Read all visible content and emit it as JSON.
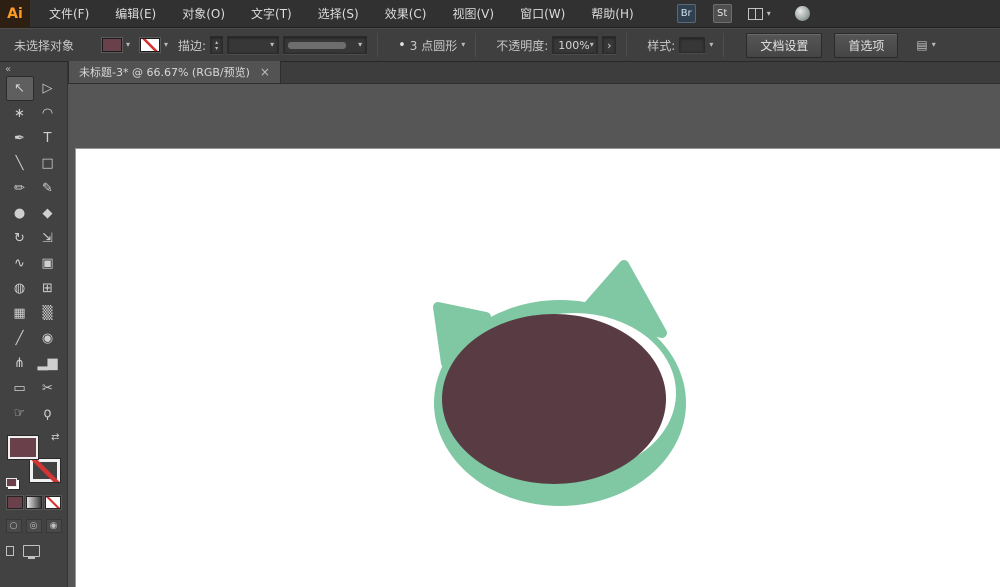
{
  "menubar": {
    "logo": "Ai",
    "items": [
      {
        "name": "file",
        "label": "文件(F)"
      },
      {
        "name": "edit",
        "label": "编辑(E)"
      },
      {
        "name": "object",
        "label": "对象(O)"
      },
      {
        "name": "type",
        "label": "文字(T)"
      },
      {
        "name": "select",
        "label": "选择(S)"
      },
      {
        "name": "effect",
        "label": "效果(C)"
      },
      {
        "name": "view",
        "label": "视图(V)"
      },
      {
        "name": "window",
        "label": "窗口(W)"
      },
      {
        "name": "help",
        "label": "帮助(H)"
      }
    ],
    "badges": [
      {
        "name": "bridge",
        "label": "Br"
      },
      {
        "name": "stock",
        "label": "St"
      }
    ]
  },
  "controlbar": {
    "status": "未选择对象",
    "stroke_label": "描边:",
    "stroke_weight_value": "",
    "brush_name": "3 点圆形",
    "opacity_label": "不透明度:",
    "opacity_value": "100%",
    "style_label": "样式:",
    "document_setup_button": "文档设置",
    "preferences_button": "首选项"
  },
  "tabbar": {
    "title": "未标题-3* @ 66.67% (RGB/预览)"
  },
  "toolbar": {
    "tools": [
      {
        "name": "selection-tool",
        "glyph": "↖",
        "selected": true
      },
      {
        "name": "direct-selection-tool",
        "glyph": "▷"
      },
      {
        "name": "magic-wand-tool",
        "glyph": "∗"
      },
      {
        "name": "lasso-tool",
        "glyph": "◠"
      },
      {
        "name": "pen-tool",
        "glyph": "✒"
      },
      {
        "name": "type-tool",
        "glyph": "T"
      },
      {
        "name": "line-tool",
        "glyph": "╲"
      },
      {
        "name": "rectangle-tool",
        "glyph": "□"
      },
      {
        "name": "paintbrush-tool",
        "glyph": "✏"
      },
      {
        "name": "pencil-tool",
        "glyph": "✎"
      },
      {
        "name": "blob-brush-tool",
        "glyph": "●"
      },
      {
        "name": "eraser-tool",
        "glyph": "◆"
      },
      {
        "name": "rotate-tool",
        "glyph": "↻"
      },
      {
        "name": "scale-tool",
        "glyph": "⇲"
      },
      {
        "name": "width-tool",
        "glyph": "∿"
      },
      {
        "name": "free-transform-tool",
        "glyph": "▣"
      },
      {
        "name": "shape-builder-tool",
        "glyph": "◍"
      },
      {
        "name": "perspective-grid-tool",
        "glyph": "⊞"
      },
      {
        "name": "mesh-tool",
        "glyph": "▦"
      },
      {
        "name": "gradient-tool",
        "glyph": "▒"
      },
      {
        "name": "eyedropper-tool",
        "glyph": "╱"
      },
      {
        "name": "blend-tool",
        "glyph": "◉"
      },
      {
        "name": "symbol-sprayer-tool",
        "glyph": "⋔"
      },
      {
        "name": "column-graph-tool",
        "glyph": "▂▆"
      },
      {
        "name": "artboard-tool",
        "glyph": "▭"
      },
      {
        "name": "slice-tool",
        "glyph": "✂"
      },
      {
        "name": "hand-tool",
        "glyph": "☞"
      },
      {
        "name": "zoom-tool",
        "glyph": "ϙ"
      }
    ],
    "drawing_modes": [
      {
        "name": "draw-normal-button",
        "glyph": "○"
      },
      {
        "name": "draw-behind-button",
        "glyph": "◎"
      },
      {
        "name": "draw-inside-button",
        "glyph": "◉"
      }
    ]
  },
  "artwork": {
    "green_color": "#7fc8a3",
    "maroon_color": "#593b43",
    "background_color": "#ffffff"
  },
  "colors": {
    "ui_fill_swatch": "#6a414b",
    "stroke_none_red": "#d33434",
    "canvas_gray": "#565656",
    "panel_gray": "#424242"
  },
  "icons": {
    "caret": "▾",
    "caret_up": "▴",
    "collapse": "«",
    "close": "×",
    "swap": "⇄",
    "chevron_right": "›",
    "brush_bullet": "•",
    "panel": "▤"
  }
}
